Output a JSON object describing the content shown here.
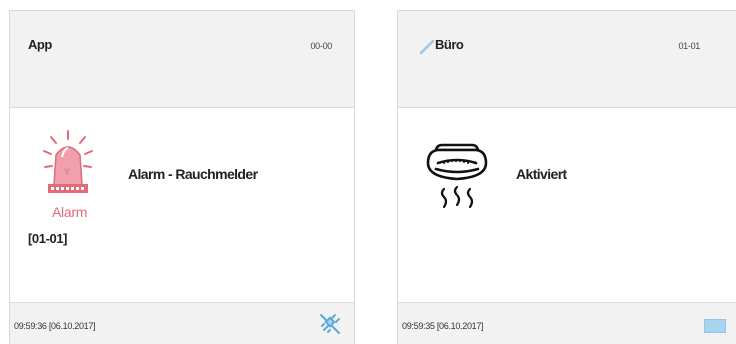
{
  "cards": [
    {
      "title": "App",
      "code": "00-00",
      "event": "Alarm - Rauchmelder",
      "icon": "siren-icon",
      "icon_caption": "Alarm",
      "zone": "[01-01]",
      "timestamp": "09:59:36 [06.10.2017]",
      "footer_icon": "plug-disconnected-icon",
      "accent_color": "#e06a78"
    },
    {
      "title": "Büro",
      "code": "01-01",
      "event": "Aktiviert",
      "icon": "smoke-detector-icon",
      "timestamp": "09:59:35 [06.10.2017]",
      "footer_icon": "status-square-icon",
      "accent_color": "#a8d4f0"
    }
  ]
}
